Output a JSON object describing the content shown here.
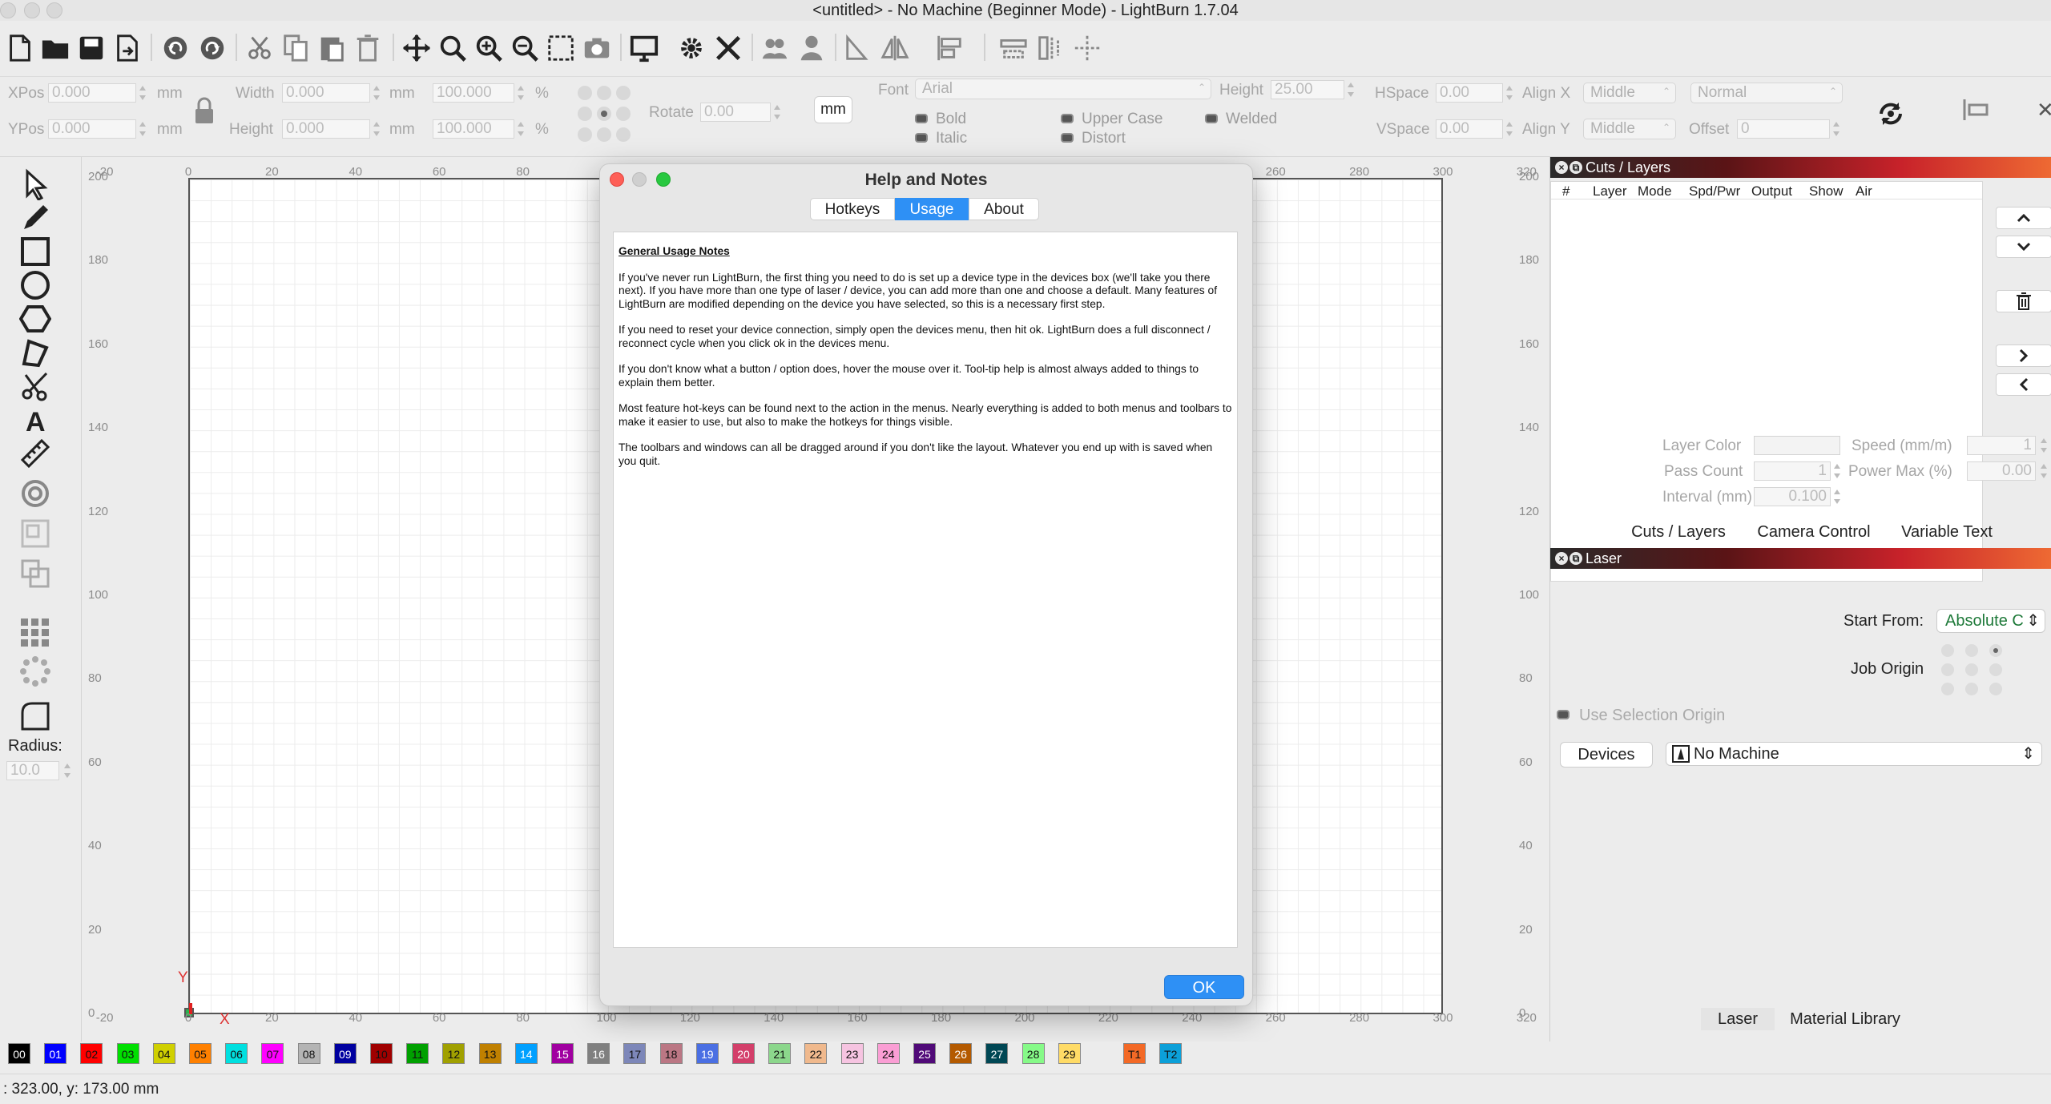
{
  "window": {
    "title": "<untitled> - No Machine (Beginner Mode) - LightBurn 1.7.04"
  },
  "props": {
    "xpos_label": "XPos",
    "xpos_value": "0.000",
    "ypos_label": "YPos",
    "ypos_value": "0.000",
    "unit_mm": "mm",
    "width_label": "Width",
    "width_value": "0.000",
    "height_label": "Height",
    "height_value": "0.000",
    "scale_w": "100.000",
    "scale_h": "100.000",
    "percent": "%",
    "rotate_label": "Rotate",
    "rotate_value": "0.00",
    "units_button": "mm",
    "font_label": "Font",
    "font_value": "Arial",
    "fheight_label": "Height",
    "fheight_value": "25.00",
    "hspace_label": "HSpace",
    "hspace_value": "0.00",
    "vspace_label": "VSpace",
    "vspace_value": "0.00",
    "alignx_label": "Align X",
    "alignx_value": "Middle",
    "aligny_label": "Align Y",
    "aligny_value": "Middle",
    "mode_value": "Normal",
    "offset_label": "Offset",
    "offset_value": "0",
    "bold": "Bold",
    "italic": "Italic",
    "upper_case": "Upper Case",
    "distort": "Distort",
    "welded": "Welded"
  },
  "tools": {
    "radius_label": "Radius:",
    "radius_value": "10.0"
  },
  "rulers": {
    "top": [
      "-20",
      "0",
      "20",
      "40",
      "60",
      "80",
      "260",
      "280",
      "300",
      "320"
    ],
    "bottom": [
      "-20",
      "0",
      "20",
      "40",
      "60",
      "80",
      "100",
      "120",
      "140",
      "160",
      "180",
      "200",
      "220",
      "240",
      "260",
      "280",
      "300",
      "320"
    ],
    "left": [
      "200",
      "180",
      "160",
      "140",
      "120",
      "100",
      "80",
      "60",
      "40",
      "20",
      "0"
    ],
    "right": [
      "200",
      "180",
      "160",
      "140",
      "120",
      "100",
      "80",
      "60",
      "40",
      "20",
      "0"
    ]
  },
  "axes": {
    "x": "X",
    "y": "Y"
  },
  "dialog": {
    "title": "Help and Notes",
    "tabs": [
      "Hotkeys",
      "Usage",
      "About"
    ],
    "active_tab": "Usage",
    "heading": "General Usage Notes",
    "paragraphs": [
      "If you've never run LightBurn, the first thing you need to do is set up a device type in the devices box (we'll take you there next).  If you have more than one type of laser / device, you can add more than one and choose a default.  Many features of LightBurn are modified depending on the device you have selected, so this is a necessary first step.",
      "If you need to reset your device connection, simply open the devices menu, then hit ok.  LightBurn does a full disconnect / reconnect cycle when you click ok in the devices menu.",
      "If you don't know what a button / option does, hover the mouse over it.  Tool-tip help is almost always added to things to explain them better.",
      "Most feature hot-keys can be found next to the action in the menus.  Nearly everything is added to both menus and toolbars to make it easier to use, but also to make the hotkeys for things visible.",
      "The toolbars and windows can all be dragged around if you don't like the layout.  Whatever you end up with is saved when you quit."
    ],
    "ok": "OK"
  },
  "cuts": {
    "title": "Cuts / Layers",
    "columns": [
      "#",
      "Layer",
      "Mode",
      "Spd/Pwr",
      "Output",
      "Show",
      "Air"
    ],
    "layer_color_label": "Layer Color",
    "speed_label": "Speed (mm/m)",
    "speed_value": "1",
    "pass_count_label": "Pass Count",
    "pass_count_value": "1",
    "power_max_label": "Power Max (%)",
    "power_max_value": "0.00",
    "interval_label": "Interval (mm)",
    "interval_value": "0.100",
    "tabs": [
      "Cuts / Layers",
      "Camera Control",
      "Variable Text"
    ]
  },
  "laser": {
    "title": "Laser",
    "start_from_label": "Start From:",
    "start_from_value": "Absolute C",
    "job_origin_label": "Job Origin",
    "use_selection_origin": "Use Selection Origin",
    "devices_button": "Devices",
    "machine_value": "No Machine",
    "tabs": [
      "Laser",
      "Material Library"
    ]
  },
  "palette": [
    {
      "id": "00",
      "color": "#000000",
      "fg": "#ffffff"
    },
    {
      "id": "01",
      "color": "#0000ff",
      "fg": "#ffffff"
    },
    {
      "id": "02",
      "color": "#ff0000",
      "fg": "#111111"
    },
    {
      "id": "03",
      "color": "#00e000",
      "fg": "#111111"
    },
    {
      "id": "04",
      "color": "#d0d000",
      "fg": "#111111"
    },
    {
      "id": "05",
      "color": "#ff8000",
      "fg": "#111111"
    },
    {
      "id": "06",
      "color": "#00e0e0",
      "fg": "#111111"
    },
    {
      "id": "07",
      "color": "#ff00ff",
      "fg": "#111111"
    },
    {
      "id": "08",
      "color": "#b4b4b4",
      "fg": "#111111"
    },
    {
      "id": "09",
      "color": "#0000a0",
      "fg": "#ffffff"
    },
    {
      "id": "10",
      "color": "#a00000",
      "fg": "#111111"
    },
    {
      "id": "11",
      "color": "#00a000",
      "fg": "#111111"
    },
    {
      "id": "12",
      "color": "#a0a000",
      "fg": "#111111"
    },
    {
      "id": "13",
      "color": "#c08000",
      "fg": "#111111"
    },
    {
      "id": "14",
      "color": "#00a0ff",
      "fg": "#ffffff"
    },
    {
      "id": "15",
      "color": "#a000a0",
      "fg": "#ffffff"
    },
    {
      "id": "16",
      "color": "#808080",
      "fg": "#ffffff"
    },
    {
      "id": "17",
      "color": "#7d87b9",
      "fg": "#111111"
    },
    {
      "id": "18",
      "color": "#bb7784",
      "fg": "#111111"
    },
    {
      "id": "19",
      "color": "#4a6fe3",
      "fg": "#ffffff"
    },
    {
      "id": "20",
      "color": "#d33f6a",
      "fg": "#ffffff"
    },
    {
      "id": "21",
      "color": "#8cd78c",
      "fg": "#111111"
    },
    {
      "id": "22",
      "color": "#f0b98d",
      "fg": "#111111"
    },
    {
      "id": "23",
      "color": "#f6c4e1",
      "fg": "#111111"
    },
    {
      "id": "24",
      "color": "#fa9ed4",
      "fg": "#111111"
    },
    {
      "id": "25",
      "color": "#500a78",
      "fg": "#ffffff"
    },
    {
      "id": "26",
      "color": "#b45a00",
      "fg": "#ffffff"
    },
    {
      "id": "27",
      "color": "#004754",
      "fg": "#ffffff"
    },
    {
      "id": "28",
      "color": "#86fa88",
      "fg": "#111111"
    },
    {
      "id": "29",
      "color": "#ffdb66",
      "fg": "#111111"
    },
    {
      "id": "T1",
      "color": "#f36926",
      "fg": "#111111"
    },
    {
      "id": "T2",
      "color": "#0ca0d9",
      "fg": "#111111"
    }
  ],
  "status": {
    "coords": ": 323.00, y: 173.00 mm"
  }
}
